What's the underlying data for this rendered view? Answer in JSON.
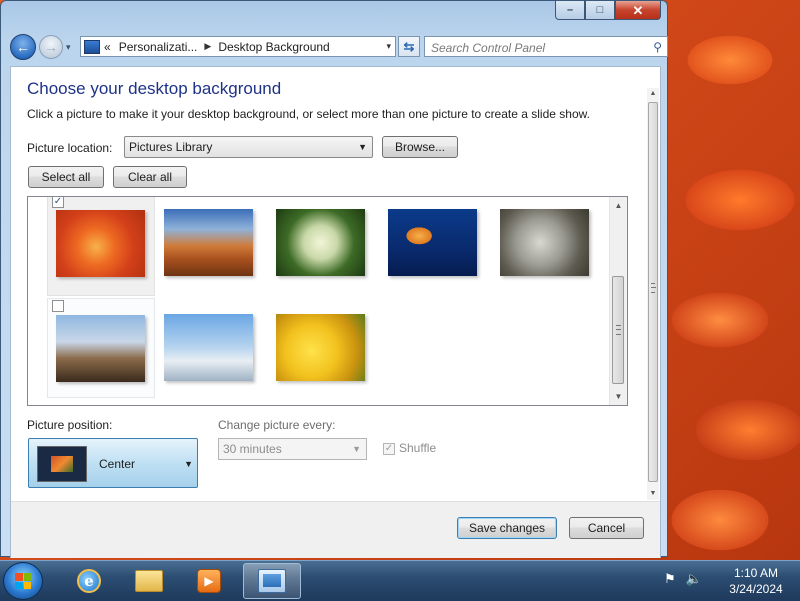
{
  "window": {
    "minimize_glyph": "–",
    "maximize_glyph": "□",
    "close_glyph": "✕"
  },
  "nav": {
    "back_arrow": "←",
    "forward_arrow": "→",
    "history_arrow": "▾",
    "breadcrumb_overflow": "«",
    "breadcrumb": [
      "Personalizati...",
      "Desktop Background"
    ],
    "breadcrumb_sep": "▶",
    "address_dropdown": "▾",
    "refresh_glyph": "⇆",
    "search_placeholder": "Search Control Panel",
    "search_glyph": "⚲"
  },
  "page": {
    "title": "Choose your desktop background",
    "description": "Click a picture to make it your desktop background, or select more than one picture to create a slide show.",
    "picture_location_label": "Picture location:",
    "picture_location_value": "Pictures Library",
    "browse_label": "Browse...",
    "select_all_label": "Select all",
    "clear_all_label": "Clear all",
    "dropdown_arrow": "▼"
  },
  "pictures": [
    {
      "name": "Chrysanthemum",
      "checked": true
    },
    {
      "name": "Desert",
      "checked": false
    },
    {
      "name": "Hydrangeas",
      "checked": false
    },
    {
      "name": "Jellyfish",
      "checked": false
    },
    {
      "name": "Koala",
      "checked": false
    },
    {
      "name": "Lighthouse",
      "checked": false
    },
    {
      "name": "Penguins",
      "checked": false
    },
    {
      "name": "Tulips",
      "checked": false
    }
  ],
  "check_glyph": "✓",
  "scroll": {
    "up": "▲",
    "down": "▼"
  },
  "position": {
    "label": "Picture position:",
    "value": "Center"
  },
  "slideshow": {
    "change_label": "Change picture every:",
    "interval_value": "30 minutes",
    "shuffle_label": "Shuffle",
    "shuffle_checked": true
  },
  "footer": {
    "save_label": "Save changes",
    "cancel_label": "Cancel"
  },
  "taskbar": {
    "ie_glyph": "e",
    "media_glyph": "▶",
    "tray_flag": "⚑",
    "tray_volume": "🔈",
    "time": "1:10 AM",
    "date": "3/24/2024"
  },
  "colors": {
    "title_blue": "#1e3287",
    "accent": "#3c7fb1"
  }
}
